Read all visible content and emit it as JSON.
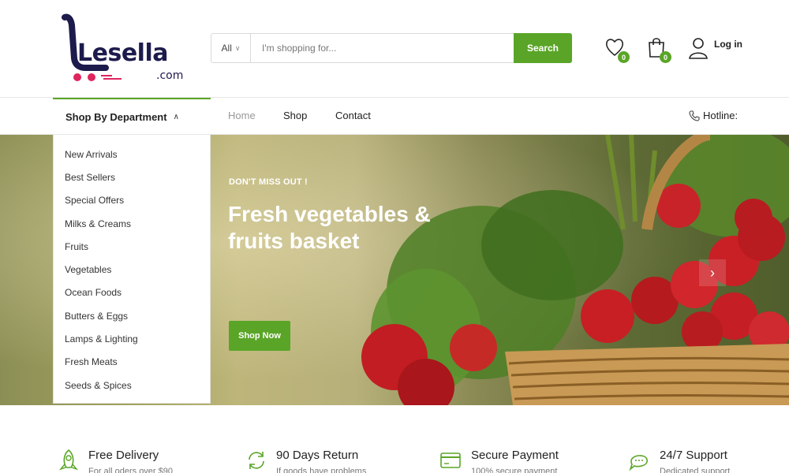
{
  "logo": {
    "brand": "Lesella",
    "suffix": ".com"
  },
  "search": {
    "category": "All",
    "placeholder": "I'm shopping for...",
    "button": "Search"
  },
  "header": {
    "wishlist_count": "0",
    "cart_count": "0",
    "login": "Log in"
  },
  "nav": {
    "department": "Shop By Department",
    "links": [
      "Home",
      "Shop",
      "Contact"
    ],
    "hotline": "Hotline:"
  },
  "departments": [
    "New Arrivals",
    "Best Sellers",
    "Special Offers",
    "Milks & Creams",
    "Fruits",
    "Vegetables",
    "Ocean Foods",
    "Butters & Eggs",
    "Lamps & Lighting",
    "Fresh Meats",
    "Seeds & Spices"
  ],
  "hero": {
    "kicker": "DON'T MISS OUT !",
    "title": "Fresh vegetables & fruits basket",
    "button": "Shop Now"
  },
  "features": [
    {
      "title": "Free Delivery",
      "sub": "For all oders over $90",
      "icon": "rocket-icon"
    },
    {
      "title": "90 Days Return",
      "sub": "If goods have problems",
      "icon": "refresh-icon"
    },
    {
      "title": "Secure Payment",
      "sub": "100% secure payment",
      "icon": "credit-card-icon"
    },
    {
      "title": "24/7 Support",
      "sub": "Dedicated support",
      "icon": "chat-icon"
    }
  ],
  "colors": {
    "accent": "#5aa527",
    "brand_dark": "#1d1b4c",
    "brand_pink": "#e0245e"
  }
}
